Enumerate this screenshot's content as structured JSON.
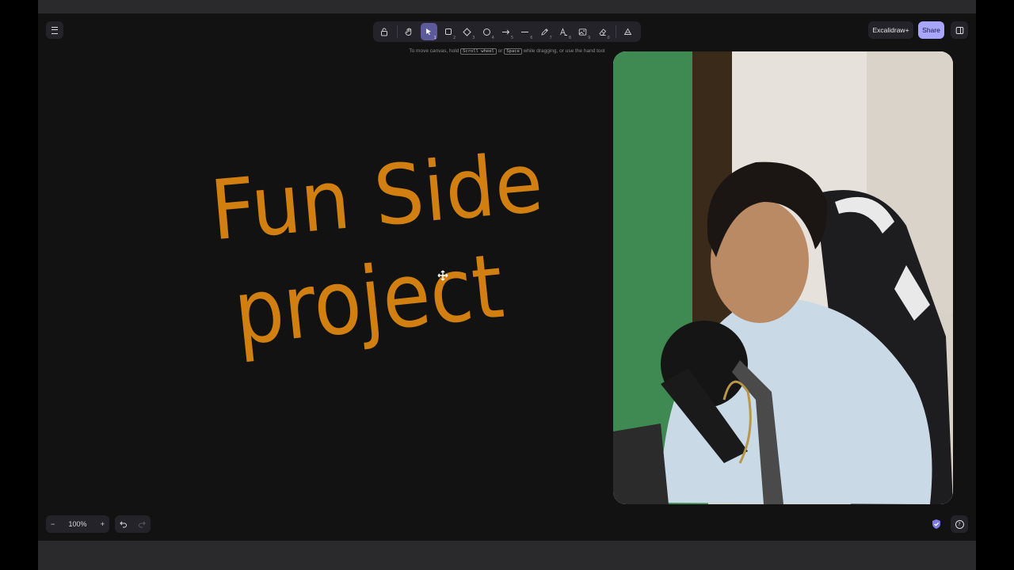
{
  "toolbar": {
    "tools": [
      {
        "name": "lock",
        "num": ""
      },
      {
        "name": "hand",
        "num": ""
      },
      {
        "name": "selection",
        "num": "1"
      },
      {
        "name": "rectangle",
        "num": "2"
      },
      {
        "name": "diamond",
        "num": "3"
      },
      {
        "name": "ellipse",
        "num": "4"
      },
      {
        "name": "arrow",
        "num": "5"
      },
      {
        "name": "line",
        "num": "6"
      },
      {
        "name": "draw",
        "num": "7"
      },
      {
        "name": "text",
        "num": "8"
      },
      {
        "name": "image",
        "num": "9"
      },
      {
        "name": "eraser",
        "num": "0"
      },
      {
        "name": "extra-tools",
        "num": ""
      }
    ],
    "active_tool": "selection"
  },
  "hint": {
    "prefix": "To move canvas, hold",
    "key1": "Scroll wheel",
    "mid": "or",
    "key2": "Space",
    "suffix": "while dragging, or use the hand tool"
  },
  "header": {
    "excalidraw_plus_label": "Excalidraw+",
    "share_label": "Share"
  },
  "canvas": {
    "line1": "Fun Side",
    "line2": "project",
    "stroke_color": "#d07f10"
  },
  "footer": {
    "zoom_out": "−",
    "zoom_level": "100%",
    "zoom_in": "+"
  },
  "colors": {
    "canvas_bg": "#121212",
    "panel_bg": "#232329",
    "accent": "#a8a5ff",
    "active_tool": "#5c5a9a"
  }
}
